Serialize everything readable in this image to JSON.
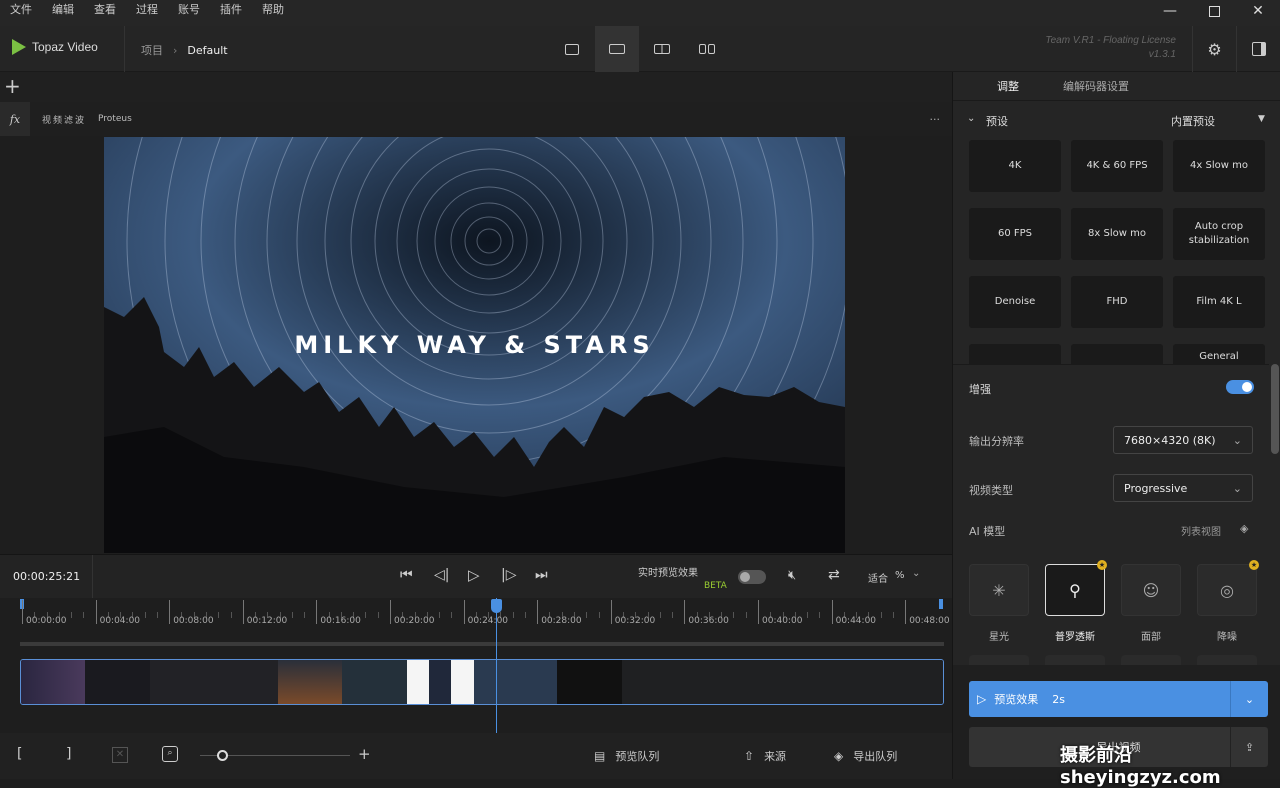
{
  "menu": [
    "文件",
    "编辑",
    "查看",
    "过程",
    "账号",
    "插件",
    "帮助"
  ],
  "app": {
    "name": "Topaz Video",
    "crumb_project": "项目",
    "crumb_current": "Default",
    "license_line1": "Team V.R1 - Floating License",
    "license_line2": "v1.3.1"
  },
  "tabs": {
    "adjust": "调整",
    "codec": "编解码器设置"
  },
  "filters": {
    "fx": "fx",
    "label": "视频滤波",
    "model": "Proteus"
  },
  "preview": {
    "overlay_text": "MILKY WAY & STARS"
  },
  "controls": {
    "timecode": "00:00:25:21",
    "realtime_label": "实时预览效果",
    "beta": "BETA",
    "zoom_label": "适合",
    "zoom_unit": "%"
  },
  "ruler": [
    "00:00:00",
    "00:04:00",
    "00:08:00",
    "00:12:00",
    "00:16:00",
    "00:20:00",
    "00:24:00",
    "00:28:00",
    "00:32:00",
    "00:36:00",
    "00:40:00",
    "00:44:00",
    "00:48:00"
  ],
  "bottom": {
    "preview_queue": "预览队列",
    "source": "来源",
    "export_queue": "导出队列"
  },
  "panel": {
    "presets_label": "预设",
    "builtin_presets": "内置预设",
    "presets": [
      "4K",
      "4K & 60 FPS",
      "4x Slow mo",
      "60 FPS",
      "8x Slow mo",
      "Auto crop stabilization",
      "Denoise",
      "FHD",
      "Film 4K L",
      "",
      "",
      "General"
    ],
    "enhance_label": "增强",
    "output_res_label": "输出分辨率",
    "output_res_value": "7680×4320 (8K)",
    "video_type_label": "视频类型",
    "video_type_value": "Progressive",
    "ai_model_label": "AI 模型",
    "list_view": "列表视图",
    "models": [
      "星光",
      "普罗透斯",
      "面部",
      "降噪"
    ],
    "preview_btn": "预览效果",
    "preview_dur": "2s",
    "export_btn": "导出视频"
  },
  "watermark": "摄影前沿 sheyingzyz.com",
  "colors": {
    "accent": "#4a90e2",
    "logo": "#7bc043",
    "beta": "#9acd32"
  }
}
